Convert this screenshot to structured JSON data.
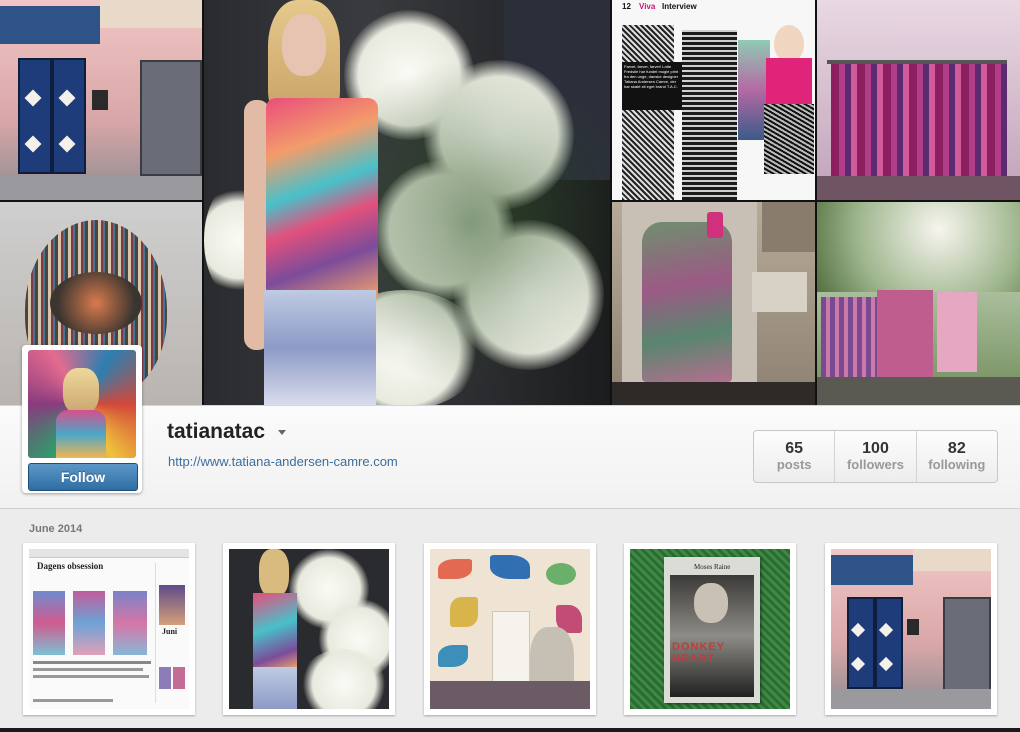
{
  "profile": {
    "username": "tatianatac",
    "website": "http://www.tatiana-andersen-camre.com",
    "follow_label": "Follow"
  },
  "stats": [
    {
      "value": "65",
      "label": "posts"
    },
    {
      "value": "100",
      "label": "followers"
    },
    {
      "value": "82",
      "label": "following"
    }
  ],
  "feed": {
    "month": "June 2014"
  },
  "magazine_tile": {
    "page_number": "12",
    "section": "Viva",
    "column": "Interview",
    "caption": "Farvet, farver, farver! Lotte Fredslie har fundet mogle print fra den unge, danske designer Tatiana Andersen Camre, der har skabt sit eget brand T.A.C."
  },
  "blog_post": {
    "heading": "Dagens obsession",
    "aside_label": "Juni"
  },
  "book_post": {
    "author": "Moses Raine",
    "title": "DONKEY HEART"
  },
  "colors": {
    "link": "#3d6e9c",
    "follow_button": "#3f7fb5",
    "background": "#ececec"
  }
}
